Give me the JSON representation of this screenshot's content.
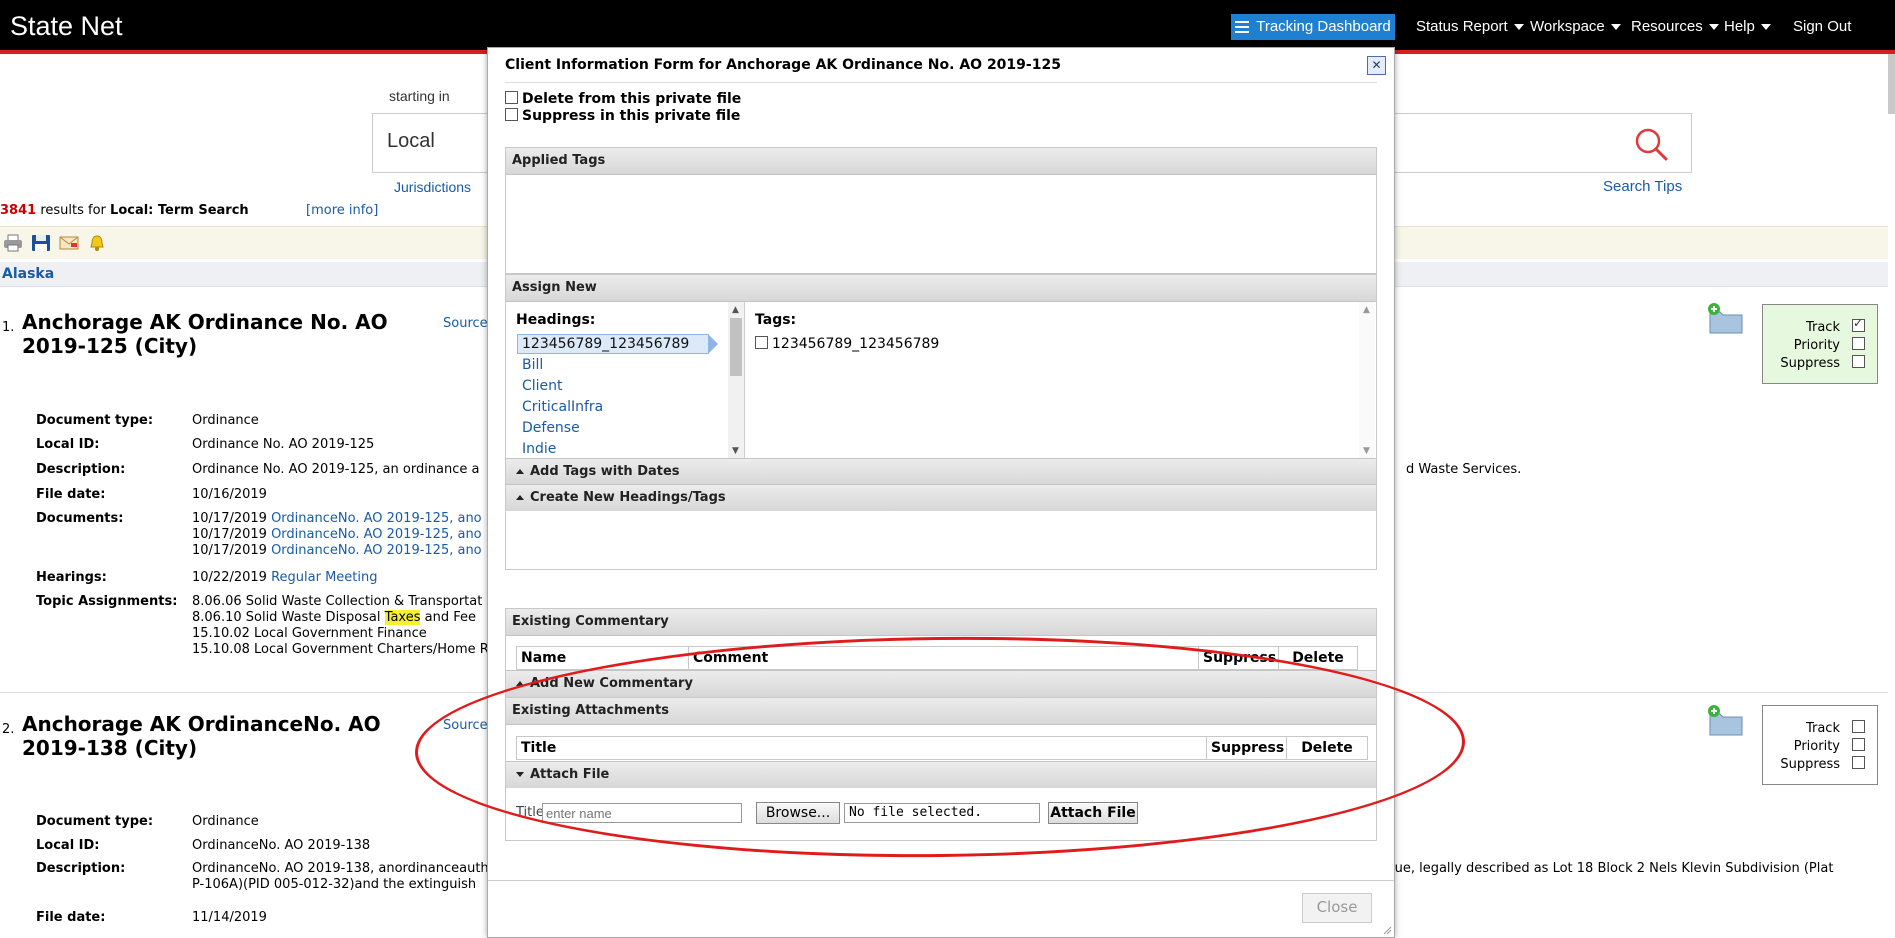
{
  "topbar": {
    "brand": "State Net",
    "nav": {
      "dashboard": "Tracking Dashboard",
      "status_report": "Status Report",
      "workspace": "Workspace",
      "resources": "Resources",
      "help": "Help",
      "sign_out": "Sign Out"
    }
  },
  "search": {
    "starting_in": "starting in",
    "scope": "Local",
    "jurisdictions_link": "Jurisdictions",
    "tips_link": "Search Tips"
  },
  "results": {
    "count": "3841",
    "results_for": "results for",
    "query": "Local: Term Search",
    "more_info": "[more info]",
    "state": "Alaska"
  },
  "items": [
    {
      "num": "1.",
      "title": "Anchorage AK Ordinance No. AO 2019-125 (City)",
      "source": "Source",
      "labels": {
        "doc_type": "Document type:",
        "local_id": "Local ID:",
        "description": "Description:",
        "file_date": "File date:",
        "documents": "Documents:",
        "hearings": "Hearings:",
        "topics": "Topic Assignments:"
      },
      "doc_type": "Ordinance",
      "local_id": "Ordinance No. AO 2019-125",
      "description": "Ordinance No. AO 2019-125, an ordinance a",
      "description_tail": "d Waste Services.",
      "file_date": "10/16/2019",
      "documents": [
        {
          "date": "10/17/2019",
          "link": "OrdinanceNo. AO 2019-125, ano"
        },
        {
          "date": "10/17/2019",
          "link": "OrdinanceNo. AO 2019-125, ano"
        },
        {
          "date": "10/17/2019",
          "link": "OrdinanceNo. AO 2019-125, ano"
        }
      ],
      "hearing_date": "10/22/2019",
      "hearing_link": "Regular Meeting",
      "topics": {
        "t1": "8.06.06 Solid Waste Collection & Transportat",
        "t2_pre": "8.06.10 Solid Waste Disposal",
        "t2_hl": "Taxes",
        "t2_post": "and Fee",
        "t3": "15.10.02 Local Government Finance",
        "t4": "15.10.08 Local Government Charters/Home R"
      },
      "track": {
        "track": "Track",
        "priority": "Priority",
        "suppress": "Suppress",
        "track_checked": true
      }
    },
    {
      "num": "2.",
      "title": "Anchorage AK OrdinanceNo. AO 2019-138 (City)",
      "source": "Source",
      "labels": {
        "doc_type": "Document type:",
        "local_id": "Local ID:",
        "description": "Description:",
        "file_date": "File date:"
      },
      "doc_type": "Ordinance",
      "local_id": "OrdinanceNo. AO 2019-138",
      "description": "OrdinanceNo. AO 2019-138, anordinanceauth",
      "description_tail": "alue, legally described as Lot 18 Block 2 Nels Klevin Subdivision (Plat",
      "description_line2": "P-106A)(PID 005-012-32)and the extinguish",
      "file_date": "11/14/2019",
      "track": {
        "track": "Track",
        "priority": "Priority",
        "suppress": "Suppress",
        "track_checked": false
      }
    }
  ],
  "modal": {
    "title": "Client Information Form for Anchorage AK Ordinance No. AO 2019-125",
    "close_x": "✕",
    "delete_label": "Delete from this private file",
    "suppress_label": "Suppress in this private file",
    "applied_tags": "Applied Tags",
    "assign_new": "Assign New",
    "headings_label": "Headings:",
    "headings": [
      "123456789_123456789",
      "Bill",
      "Client",
      "CriticalInfra",
      "Defense",
      "Indie"
    ],
    "tags_label": "Tags:",
    "tags": [
      "123456789_123456789"
    ],
    "add_tags_dates": "Add Tags with Dates",
    "create_headings": "Create New Headings/Tags",
    "existing_commentary": "Existing Commentary",
    "commentary_cols": {
      "name": "Name",
      "comment": "Comment",
      "suppress": "Suppress",
      "delete": "Delete"
    },
    "add_commentary": "Add New Commentary",
    "existing_attachments": "Existing Attachments",
    "attach_cols": {
      "title": "Title",
      "suppress": "Suppress",
      "delete": "Delete"
    },
    "attach_file_section": "Attach File",
    "title_label": "Title",
    "title_placeholder": "enter name",
    "browse": "Browse...",
    "no_file": "No file selected.",
    "attach_button": "Attach File",
    "close_button": "Close"
  },
  "colors": {
    "accent_red": "#d81e1e",
    "nav_blue": "#1f7fd1",
    "link": "#1a5aa6",
    "annotation": "#e01b1b"
  }
}
